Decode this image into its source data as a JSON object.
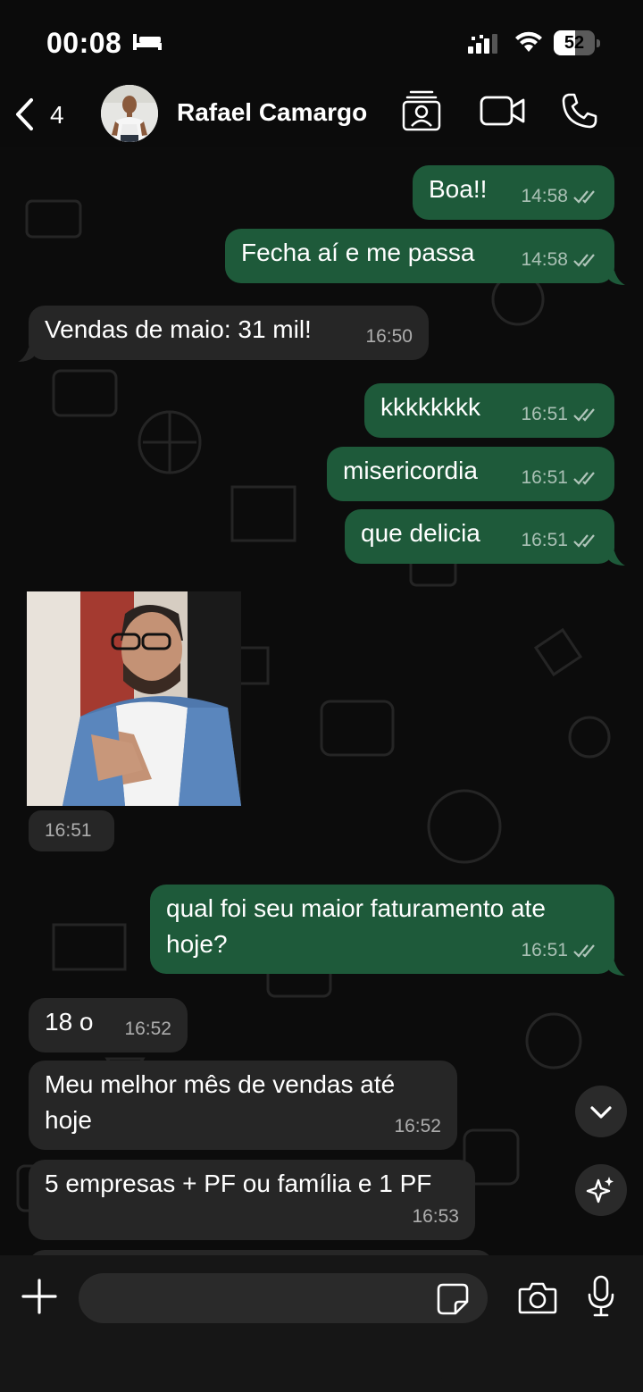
{
  "status_bar": {
    "time": "00:08",
    "battery": "52",
    "battery_level_percent": 52,
    "icons": [
      "bed-icon",
      "signal-icon",
      "wifi-icon",
      "battery-icon"
    ]
  },
  "header": {
    "unread_count": "4",
    "contact_name": "Rafael Camargo",
    "icons": [
      "back-chevron-icon",
      "contact-card-icon",
      "video-call-icon",
      "phone-icon"
    ]
  },
  "messages": [
    {
      "direction": "out",
      "text": "Boa!!",
      "time": "14:58",
      "status": "read"
    },
    {
      "direction": "out",
      "text": "Fecha aí e me passa",
      "time": "14:58",
      "status": "read"
    },
    {
      "direction": "in",
      "text": "Vendas de maio: 31 mil!",
      "time": "16:50"
    },
    {
      "direction": "out",
      "text": "kkkkkkkk",
      "time": "16:51",
      "status": "read"
    },
    {
      "direction": "out",
      "text": "misericordia",
      "time": "16:51",
      "status": "read"
    },
    {
      "direction": "out",
      "text": "que delicia",
      "time": "16:51",
      "status": "read"
    },
    {
      "direction": "in",
      "type": "image",
      "time": "16:51"
    },
    {
      "direction": "out",
      "text_line1": "qual foi seu maior faturamento ate",
      "text_line2": "hoje?",
      "time": "16:51",
      "status": "read"
    },
    {
      "direction": "in",
      "text": "18 o",
      "time": "16:52"
    },
    {
      "direction": "in",
      "text_line1": "Meu melhor mês de vendas até",
      "text_line2": "hoje",
      "time": "16:52"
    },
    {
      "direction": "in",
      "text": "5 empresas + PF ou família e 1 PF",
      "time": "16:53"
    }
  ],
  "floating_buttons": [
    "scroll-down-icon",
    "ai-sparkle-icon"
  ],
  "composer": {
    "placeholder": "",
    "value": "",
    "icons": [
      "plus-icon",
      "sticker-icon",
      "camera-icon",
      "microphone-icon"
    ]
  },
  "colors": {
    "outgoing_bubble": "#1e5a3a",
    "incoming_bubble": "#262626",
    "background": "#0b0b0b"
  }
}
